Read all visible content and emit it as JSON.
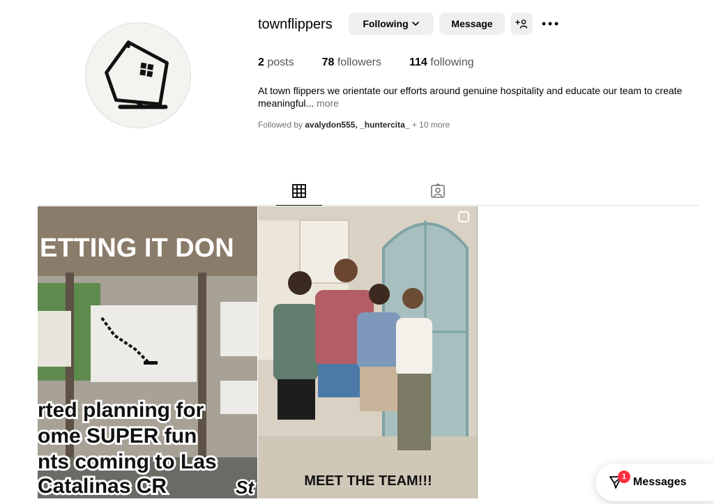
{
  "profile": {
    "username": "townflippers",
    "following_label": "Following",
    "message_label": "Message",
    "stats": {
      "posts_count": "2",
      "posts_label": "posts",
      "followers_count": "78",
      "followers_label": "followers",
      "following_count": "114",
      "following_label": "following"
    },
    "bio": "At town flippers we orientate our efforts around genuine hospitality and educate our team to create meaningful...",
    "bio_more": "more",
    "followed_by_prefix": "Followed by",
    "followed_by_names": "avalydon555, _huntercita_",
    "followed_by_more": "+ 10 more"
  },
  "tabs": [
    "grid-icon",
    "tagged-icon"
  ],
  "posts": [
    {
      "lines": [
        "ETTING IT DON",
        "rted planning for",
        "ome SUPER fun",
        "nts coming to Las",
        "Catalinas CR"
      ],
      "corner_text": "St"
    },
    {
      "caption": "MEET THE TEAM!!!"
    }
  ],
  "messages": {
    "label": "Messages",
    "badge": "1"
  },
  "colors": {
    "button_bg": "#efefef",
    "notification": "#ff3040",
    "muted_text": "#737373"
  }
}
